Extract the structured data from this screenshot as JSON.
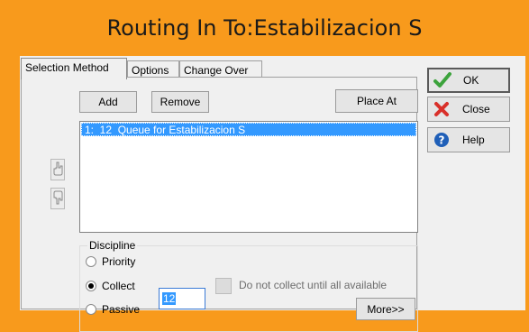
{
  "window": {
    "title": "Routing In To:Estabilizacion S"
  },
  "tabs": [
    {
      "label": "Selection Method",
      "active": true
    },
    {
      "label": "Options",
      "active": false
    },
    {
      "label": "Change Over",
      "active": false
    }
  ],
  "buttons": {
    "add": "Add",
    "remove": "Remove",
    "place_at": "Place At",
    "more": "More>>",
    "ok": "OK",
    "close": "Close",
    "help": "Help"
  },
  "list": {
    "items": [
      "1:  12  Queue for Estabilizacion S"
    ],
    "selected_index": 0
  },
  "icons": {
    "move_up": "hand-up-icon",
    "move_down": "hand-down-icon",
    "ok": "checkmark-icon",
    "close": "red-x-icon",
    "help": "question-icon"
  },
  "discipline": {
    "label": "Discipline",
    "options": [
      {
        "label": "Priority",
        "selected": false
      },
      {
        "label": "Collect",
        "selected": true
      },
      {
        "label": "Passive",
        "selected": false
      }
    ],
    "collect_value": "12",
    "checkbox_label": "Do not collect until all available",
    "checkbox_checked": false
  },
  "colors": {
    "frame": "#f89a1c",
    "selection": "#3399ff",
    "ok_check": "#3ca33c",
    "close_x": "#d9302a",
    "help_circle": "#1f5fb8"
  }
}
